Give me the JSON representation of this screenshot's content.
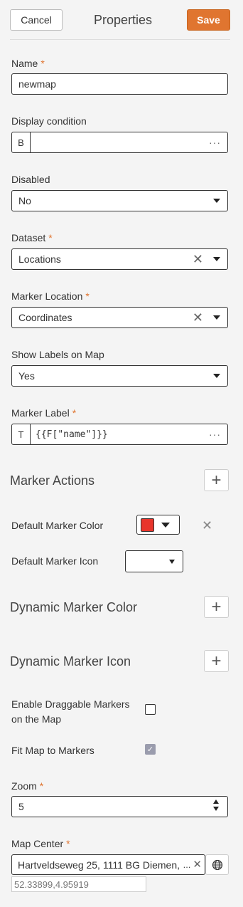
{
  "header": {
    "cancel_label": "Cancel",
    "title": "Properties",
    "save_label": "Save"
  },
  "name": {
    "label": "Name",
    "required": "*",
    "value": "newmap"
  },
  "display_condition": {
    "label": "Display condition",
    "prefix": "B",
    "value": "",
    "more": "···"
  },
  "disabled": {
    "label": "Disabled",
    "value": "No"
  },
  "dataset": {
    "label": "Dataset",
    "required": "*",
    "value": "Locations",
    "clear": "✕"
  },
  "marker_location": {
    "label": "Marker Location",
    "required": "*",
    "value": "Coordinates",
    "clear": "✕"
  },
  "show_labels": {
    "label": "Show Labels on Map",
    "value": "Yes"
  },
  "marker_label": {
    "label": "Marker Label",
    "required": "*",
    "prefix": "T",
    "value": "{{F[\"name\"]}}",
    "more": "···"
  },
  "marker_actions": {
    "title": "Marker Actions",
    "add": "+"
  },
  "default_marker_color": {
    "label": "Default Marker Color",
    "color": "#e8352c",
    "clear": "✕"
  },
  "default_marker_icon": {
    "label": "Default Marker Icon"
  },
  "dynamic_marker_color": {
    "title": "Dynamic Marker Color",
    "add": "+"
  },
  "dynamic_marker_icon": {
    "title": "Dynamic Marker Icon",
    "add": "+"
  },
  "draggable": {
    "label_line1": "Enable Draggable Markers",
    "label_line2": "on the Map",
    "checked": false
  },
  "fit_map": {
    "label": "Fit Map to Markers",
    "checked": true,
    "check": "✓"
  },
  "zoom": {
    "label": "Zoom",
    "required": "*",
    "value": "5"
  },
  "map_center": {
    "label": "Map Center",
    "required": "*",
    "value": "Hartveldseweg 25, 1111 BG Diemen,",
    "ellipsis": "...",
    "clear": "✕",
    "coords": "52.33899,4.95919"
  },
  "colors": {
    "accent": "#e07530",
    "marker_red": "#e8352c",
    "checkbox_checked": "#9a9cad"
  }
}
